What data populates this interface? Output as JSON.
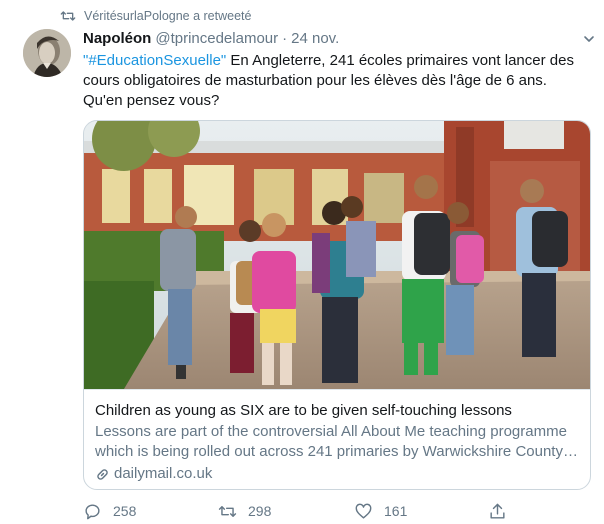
{
  "retweet": {
    "icon": "retweet-icon",
    "text": "VéritésurlaPologne a retweeté"
  },
  "author": {
    "name": "Napoléon",
    "handle": "@tprincedelamour",
    "separator": "·",
    "time": "24 nov."
  },
  "tweet": {
    "hashtag": "\"#EducationSexuelle\"",
    "body": " En Angleterre, 241 écoles primaires vont lancer des cours obligatoires de masturbation pour les élèves dès l'âge de 6 ans. Qu'en pensez vous?"
  },
  "card": {
    "image_alt": "children walking with school backpacks",
    "title": "Children as young as SIX are to be given self-touching lessons",
    "desc_line1": "Lessons are part of the controversial All About Me teaching programme",
    "desc_line2": "which is being rolled out across 241 primaries by Warwickshire County ...",
    "domain": "dailymail.co.uk"
  },
  "actions": {
    "reply_count": "258",
    "retweet_count": "298",
    "like_count": "161",
    "share_label": ""
  },
  "colors": {
    "accent": "#1b95e0",
    "muted": "#657786",
    "text": "#14171a",
    "border": "#ccd6dd"
  }
}
